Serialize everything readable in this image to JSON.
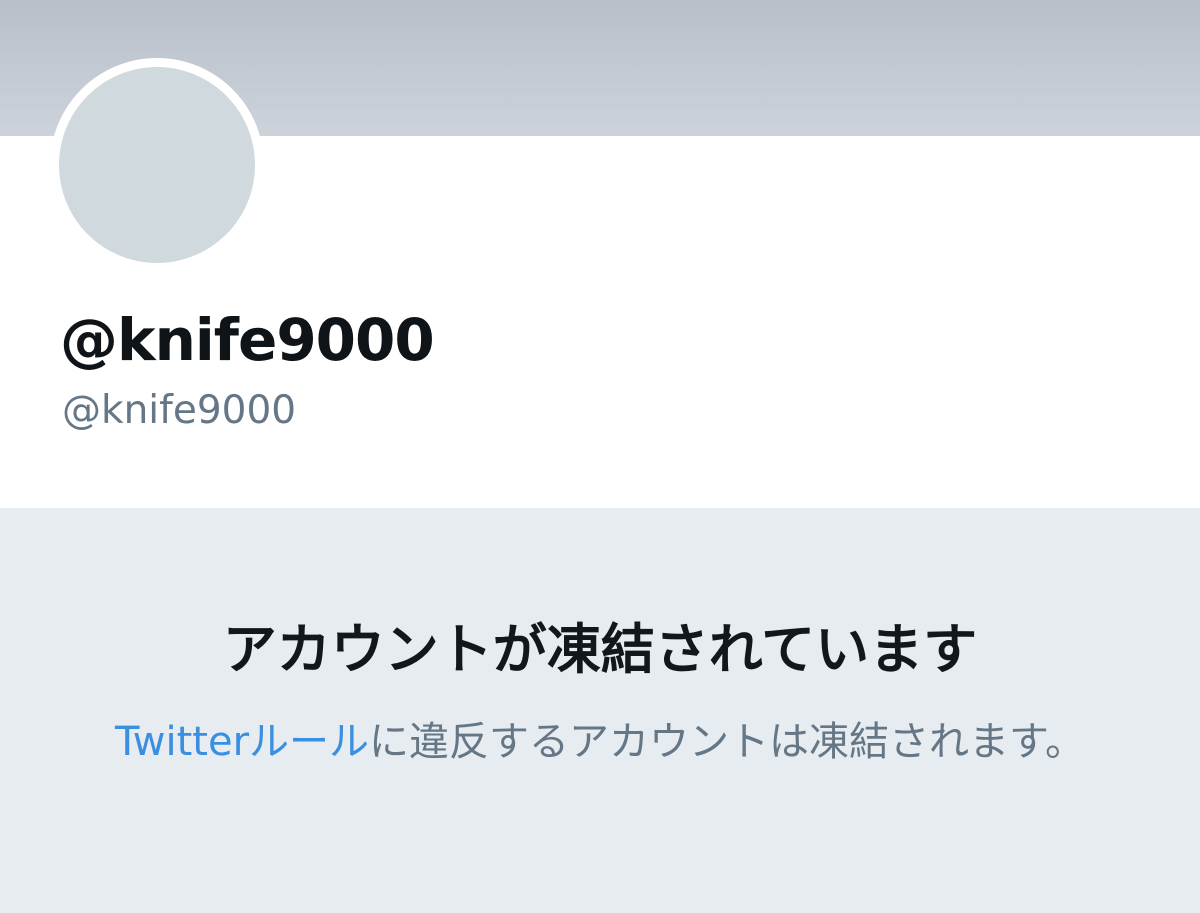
{
  "profile": {
    "display_name": "@knife9000",
    "handle": "@knife9000"
  },
  "suspension": {
    "title": "アカウントが凍結されています",
    "rules_link_label": "Twitterルール",
    "message_rest": "に違反するアカウントは凍結されます。"
  },
  "colors": {
    "banner": "#c4cbd3",
    "avatar_placeholder": "#cfd9de",
    "notice_background": "#e6ecf0",
    "link": "#3a8fe0",
    "secondary_text": "#657786"
  }
}
